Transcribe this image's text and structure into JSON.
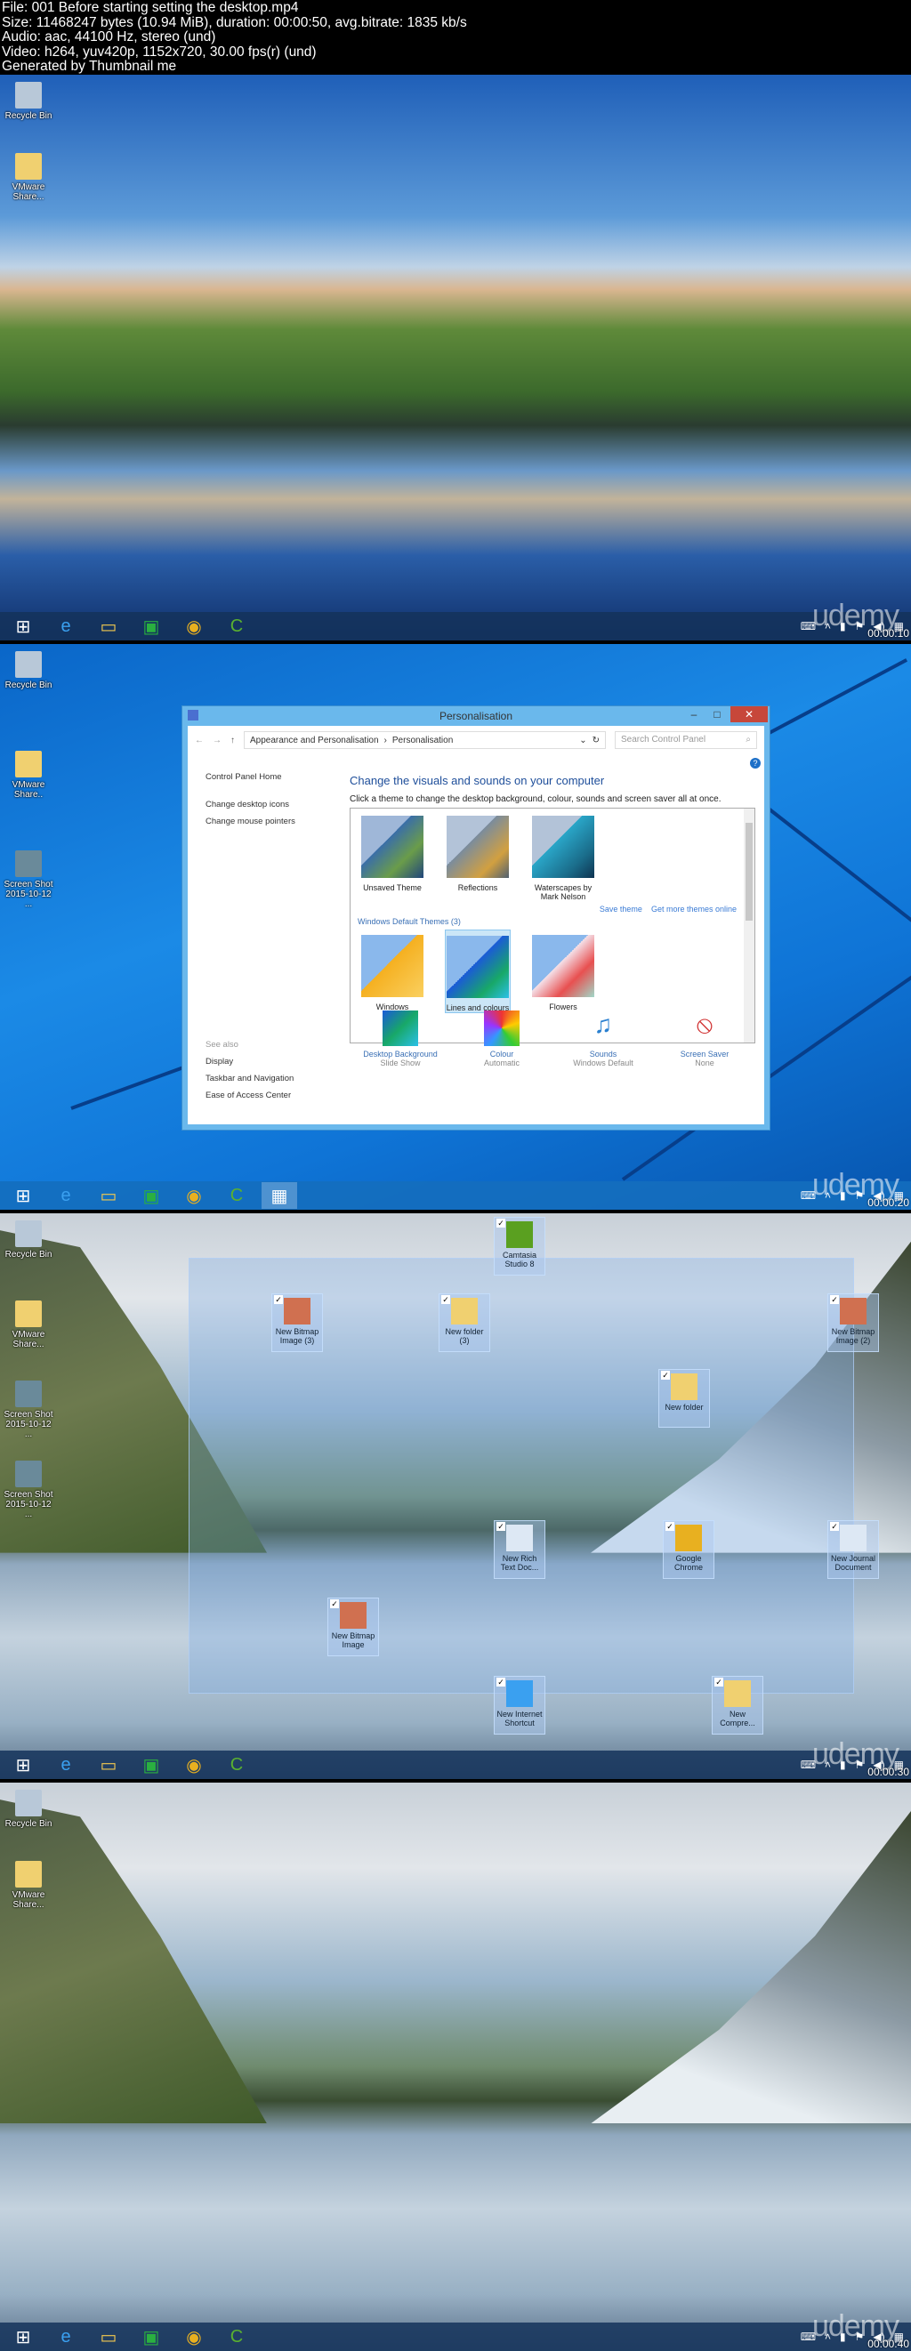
{
  "header": {
    "lines": [
      "File: 001 Before starting setting the desktop.mp4",
      "Size: 11468247 bytes (10.94 MiB), duration: 00:00:50, avg.bitrate: 1835 kb/s",
      "Audio: aac, 44100 Hz, stereo (und)",
      "Video: h264, yuv420p, 1152x720, 30.00 fps(r) (und)",
      "Generated by Thumbnail me"
    ]
  },
  "watermark": "udemy",
  "frames": [
    {
      "timestamp": "00:00:10",
      "desktop_icons": [
        "Recycle Bin",
        "VMware Share..."
      ]
    },
    {
      "timestamp": "00:00:20",
      "desktop_icons": [
        "Recycle Bin",
        "VMware Share..",
        "Screen Shot 2015-10-12 ..."
      ]
    },
    {
      "timestamp": "00:00:30",
      "desktop_icons": [
        "Recycle Bin",
        "VMware Share...",
        "Screen Shot 2015-10-12 ...",
        "Screen Shot 2015-10-12 ..."
      ],
      "selected_icons": [
        "Camtasia Studio 8",
        "New Bitmap Image (3)",
        "New folder (3)",
        "New folder",
        "New Bitmap Image (2)",
        "New Rich Text Doc...",
        "Google Chrome",
        "New Journal Document",
        "New Bitmap Image",
        "New Internet Shortcut",
        "New Compre..."
      ]
    },
    {
      "timestamp": "00:00:40",
      "desktop_icons": [
        "Recycle Bin",
        "VMware Share..."
      ]
    }
  ],
  "taskbar_icons": [
    "start-icon",
    "internet-explorer-icon",
    "file-explorer-icon",
    "store-icon",
    "chrome-icon",
    "camtasia-icon"
  ],
  "window": {
    "title": "Personalisation",
    "breadcrumb": [
      "Appearance and Personalisation",
      "Personalisation"
    ],
    "search_placeholder": "Search Control Panel",
    "left_links": [
      "Control Panel Home",
      "Change desktop icons",
      "Change mouse pointers"
    ],
    "see_also_label": "See also",
    "see_also": [
      "Display",
      "Taskbar and Navigation",
      "Ease of Access Center"
    ],
    "heading": "Change the visuals and sounds on your computer",
    "subheading": "Click a theme to change the desktop background, colour, sounds and screen saver all at once.",
    "my_themes": [
      "Unsaved Theme",
      "Reflections",
      "Waterscapes by Mark Nelson"
    ],
    "save_theme": "Save theme",
    "get_more": "Get more themes online",
    "default_group": "Windows Default Themes (3)",
    "default_themes": [
      "Windows",
      "Lines and colours",
      "Flowers"
    ],
    "selected_theme": "Lines and colours",
    "settings": [
      {
        "label": "Desktop Background",
        "value": "Slide Show"
      },
      {
        "label": "Colour",
        "value": "Automatic"
      },
      {
        "label": "Sounds",
        "value": "Windows Default"
      },
      {
        "label": "Screen Saver",
        "value": "None"
      }
    ]
  }
}
